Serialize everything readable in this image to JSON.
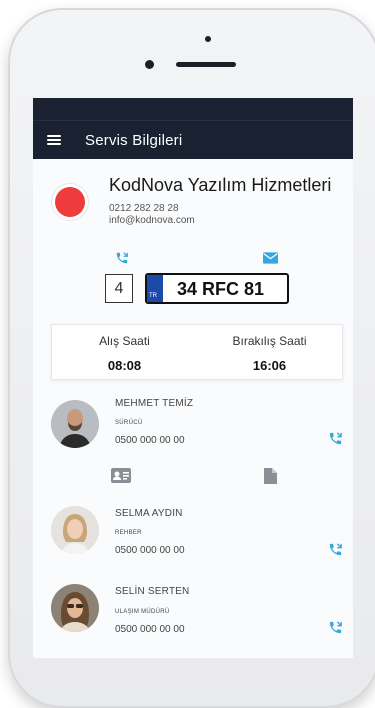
{
  "app": {
    "title": "Servis Bilgileri"
  },
  "company": {
    "name": "KodNova Yazılım Hizmetleri",
    "phone": "0212 282 28 28",
    "email": "info@kodnova.com",
    "status_color": "#ee3b3b"
  },
  "vehicle": {
    "number": "4",
    "plate_country": "TR",
    "plate": "34 RFC 81"
  },
  "times": {
    "pickup_label": "Alış Saati",
    "pickup_value": "08:08",
    "dropoff_label": "Bırakılış Saati",
    "dropoff_value": "16:06"
  },
  "people": [
    {
      "name": "MEHMET TEMİZ",
      "role": "SÜRÜCÜ",
      "phone": "0500 000 00 00"
    },
    {
      "name": "SELMA AYDIN",
      "role": "REHBER",
      "phone": "0500 000 00 00"
    },
    {
      "name": "SELİN SERTEN",
      "role": "ULAŞIM MÜDÜRÜ",
      "phone": "0500 000 00 00"
    }
  ],
  "icons": {
    "menu": "hamburger-icon",
    "call": "phone-icon",
    "mail": "mail-icon",
    "vcard": "id-card-icon",
    "document": "document-icon"
  },
  "colors": {
    "appbar": "#1a2231",
    "accent": "#35a7dc",
    "plate_band": "#1d4aa8"
  }
}
